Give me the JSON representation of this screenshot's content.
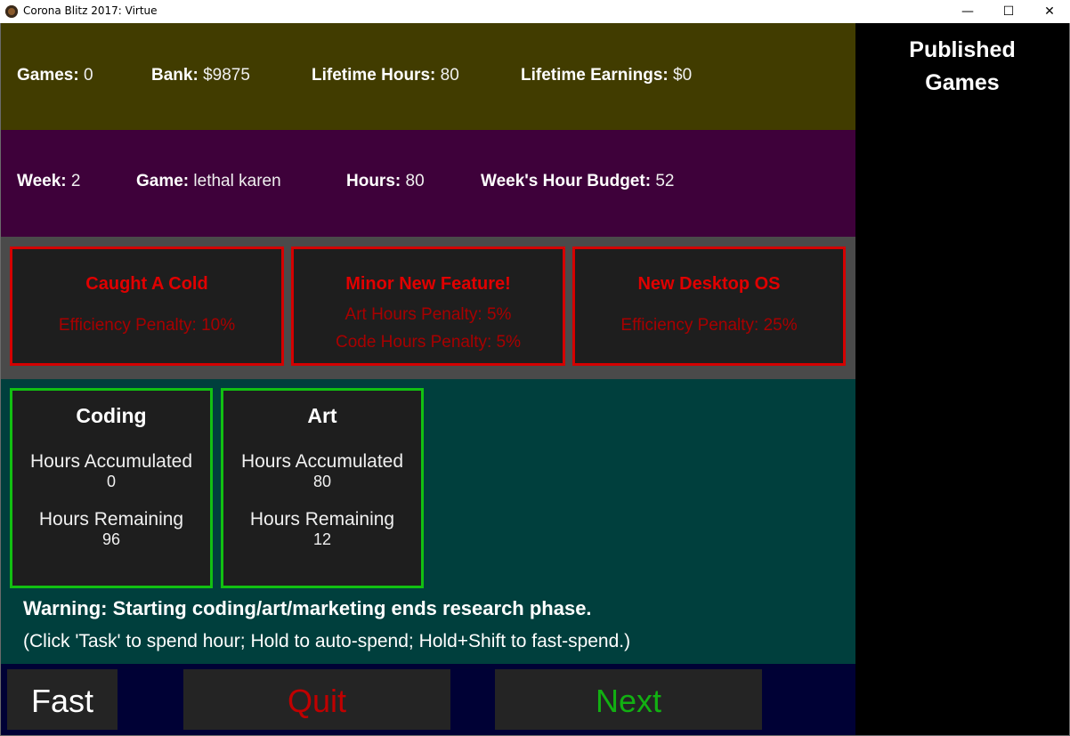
{
  "window": {
    "title": "Corona Blitz 2017: Virtue",
    "minimize_glyph": "—",
    "maximize_glyph": "☐",
    "close_glyph": "✕"
  },
  "sidebar": {
    "title_line1": "Published",
    "title_line2": "Games"
  },
  "stats": {
    "games_label": "Games:",
    "games_value": "0",
    "bank_label": "Bank:",
    "bank_value": "$9875",
    "lifetime_hours_label": "Lifetime Hours:",
    "lifetime_hours_value": "80",
    "lifetime_earnings_label": "Lifetime Earnings:",
    "lifetime_earnings_value": "$0"
  },
  "week": {
    "week_label": "Week:",
    "week_value": "2",
    "game_label": "Game:",
    "game_value": "lethal karen",
    "hours_label": "Hours:",
    "hours_value": "80",
    "budget_label": "Week's Hour Budget:",
    "budget_value": "52"
  },
  "events": [
    {
      "title": "Caught A Cold",
      "lines": [
        "Efficiency Penalty: 10%"
      ]
    },
    {
      "title": "Minor New Feature!",
      "lines": [
        "Art Hours Penalty: 5%",
        "Code Hours Penalty: 5%"
      ]
    },
    {
      "title": "New Desktop OS",
      "lines": [
        "Efficiency Penalty: 25%"
      ]
    }
  ],
  "tasks": [
    {
      "title": "Coding",
      "acc_label": "Hours Accumulated",
      "acc_value": "0",
      "rem_label": "Hours Remaining",
      "rem_value": "96"
    },
    {
      "title": "Art",
      "acc_label": "Hours Accumulated",
      "acc_value": "80",
      "rem_label": "Hours Remaining",
      "rem_value": "12"
    }
  ],
  "warning": "Warning: Starting coding/art/marketing ends research phase.",
  "hint": "(Click 'Task' to spend hour; Hold to auto-spend; Hold+Shift to fast-spend.)",
  "buttons": {
    "fast": "Fast",
    "quit": "Quit",
    "next": "Next"
  },
  "colors": {
    "stats_bg": "#413c00",
    "week_bg": "#3e013a",
    "events_bg": "#4a4a4a",
    "tasks_bg": "#003f3d",
    "bottom_bg": "#000135",
    "event_border": "#d40000",
    "task_border": "#12c012",
    "quit_text": "#c00000",
    "next_text": "#12b012"
  }
}
